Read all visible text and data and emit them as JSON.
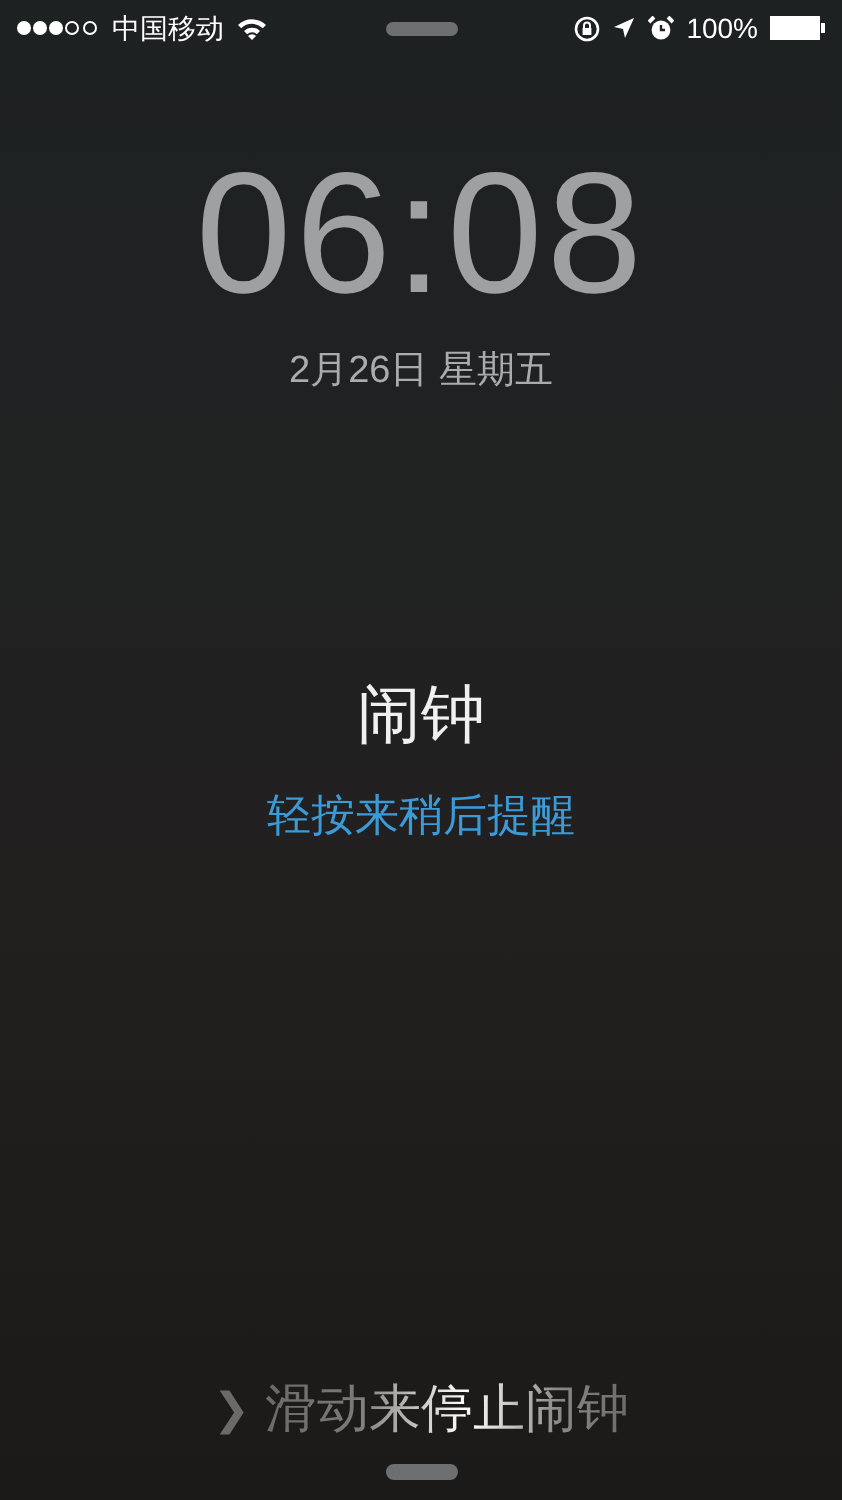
{
  "status_bar": {
    "carrier": "中国移动",
    "battery": "100%"
  },
  "lock_screen": {
    "time": "06:08",
    "date": "2月26日 星期五"
  },
  "alarm": {
    "title": "闹钟",
    "snooze_hint": "轻按来稍后提醒"
  },
  "slider": {
    "chevron": "❯",
    "label": "滑动来停止闹钟"
  }
}
